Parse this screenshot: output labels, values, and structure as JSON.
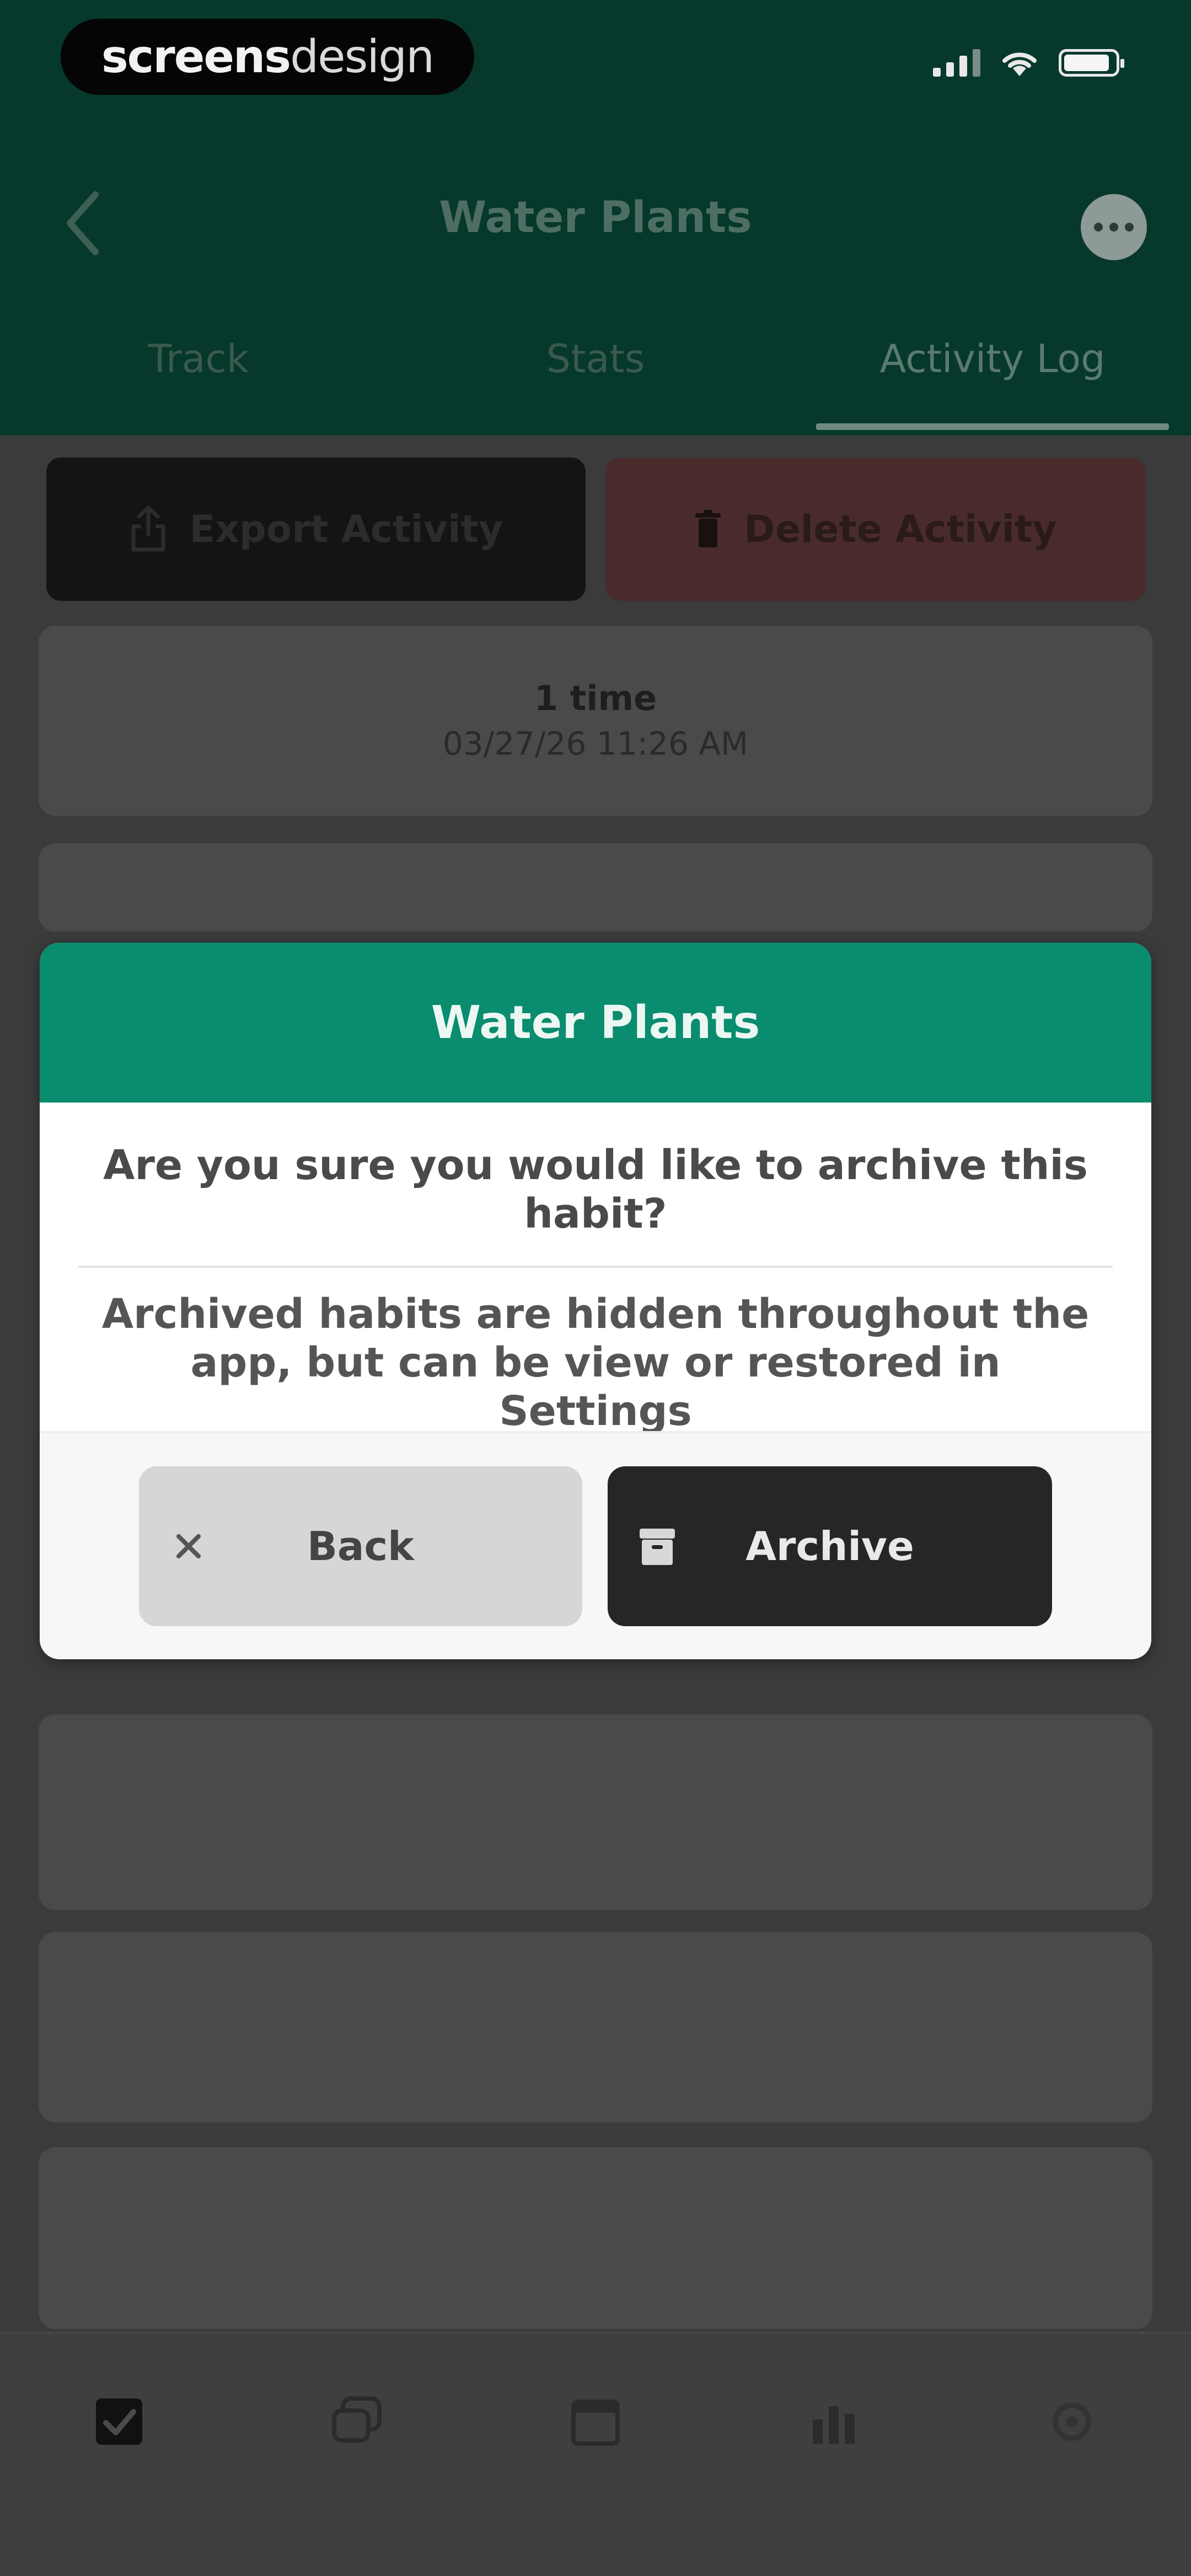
{
  "status_bar": {
    "brand_bold": "screens",
    "brand_light": "design",
    "icons": [
      "signal-icon",
      "wifi-icon",
      "battery-icon"
    ]
  },
  "header": {
    "back_icon": "chevron-left-icon",
    "title": "Water Plants",
    "more_icon": "more-horizontal-icon",
    "tabs": [
      {
        "label": "Track",
        "active": false
      },
      {
        "label": "Stats",
        "active": false
      },
      {
        "label": "Activity Log",
        "active": true
      }
    ]
  },
  "actions": {
    "export_label": "Export Activity",
    "export_icon": "share-icon",
    "delete_label": "Delete Activity",
    "delete_icon": "trash-icon"
  },
  "log_entries": [
    {
      "title": "1 time",
      "date": "03/27/26 11:26 AM"
    }
  ],
  "dialog": {
    "title": "Water Plants",
    "question": "Are you sure you would like to archive this habit?",
    "note": "Archived habits are hidden throughout the app, but can be view or restored in Settings",
    "back_label": "Back",
    "back_icon": "close-icon",
    "archive_label": "Archive",
    "archive_icon": "archive-box-icon"
  },
  "bottom_nav": [
    {
      "icon": "checkbox-icon",
      "active": true
    },
    {
      "icon": "chat-bubbles-icon",
      "active": false
    },
    {
      "icon": "calendar-icon",
      "active": false
    },
    {
      "icon": "chart-bars-icon",
      "active": false
    },
    {
      "icon": "settings-icon",
      "active": false
    }
  ],
  "colors": {
    "header_bg": "#06382c",
    "dialog_header": "#0a8c6e",
    "archive_button": "#262626",
    "back_button": "#d6d6d6",
    "overlay_bg": "#3b3b3b"
  }
}
